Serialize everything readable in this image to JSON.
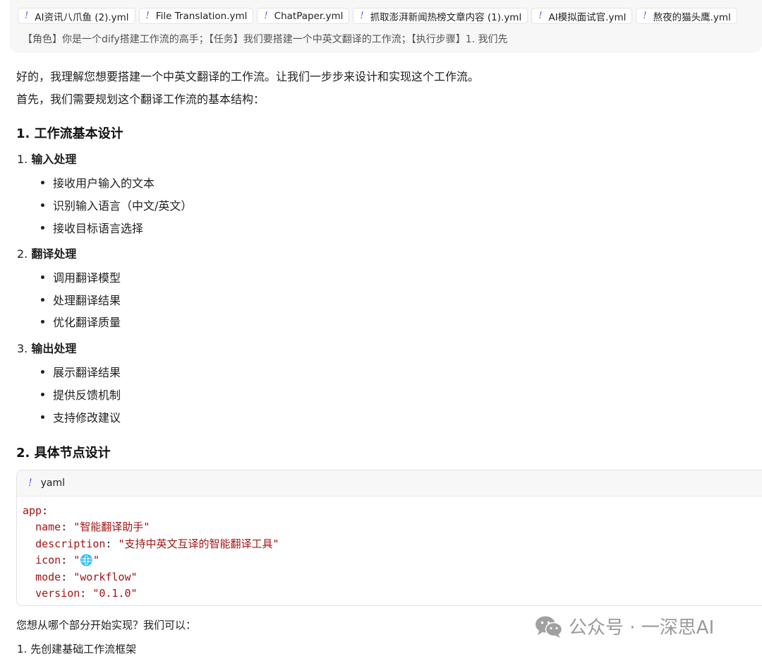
{
  "attachments": [
    {
      "label": "AI资讯八爪鱼 (2).yml"
    },
    {
      "label": "File Translation.yml"
    },
    {
      "label": "ChatPaper.yml"
    },
    {
      "label": "抓取澎湃新闻热榜文章内容 (1).yml"
    },
    {
      "label": "AI模拟面试官.yml"
    },
    {
      "label": "熬夜的猫头鹰.yml"
    }
  ],
  "attachment_icon": "!",
  "prompt_text": "【角色】你是一个dify搭建工作流的高手；【任务】我们要搭建一个中英文翻译的工作流；【执行步骤】1. 我们先",
  "answer": {
    "intro1": "好的，我理解您想要搭建一个中英文翻译的工作流。让我们一步步来设计和实现这个工作流。",
    "intro2": "首先，我们需要规划这个翻译工作流的基本结构：",
    "section1_title": "1. 工作流基本设计",
    "steps": [
      {
        "num": "1.",
        "title": "输入处理",
        "items": [
          "接收用户输入的文本",
          "识别输入语言（中文/英文）",
          "接收目标语言选择"
        ]
      },
      {
        "num": "2.",
        "title": "翻译处理",
        "items": [
          "调用翻译模型",
          "处理翻译结果",
          "优化翻译质量"
        ]
      },
      {
        "num": "3.",
        "title": "输出处理",
        "items": [
          "展示翻译结果",
          "提供反馈机制",
          "支持修改建议"
        ]
      }
    ],
    "section2_title": "2. 具体节点设计",
    "code": {
      "lang": "yaml",
      "root_key": "app",
      "fields": [
        {
          "key": "name",
          "value": "\"智能翻译助手\""
        },
        {
          "key": "description",
          "value": "\"支持中英文互译的智能翻译工具\""
        },
        {
          "key": "icon",
          "value": "\"🌐\""
        },
        {
          "key": "mode",
          "value": "\"workflow\""
        },
        {
          "key": "version",
          "value": "\"0.1.0\""
        }
      ]
    },
    "question": "您想从哪个部分开始实现？我们可以：",
    "option1": "1. 先创建基础工作流框架"
  },
  "watermark": {
    "text": "公众号 · 一深思AI",
    "icon": "wechat-icon"
  }
}
